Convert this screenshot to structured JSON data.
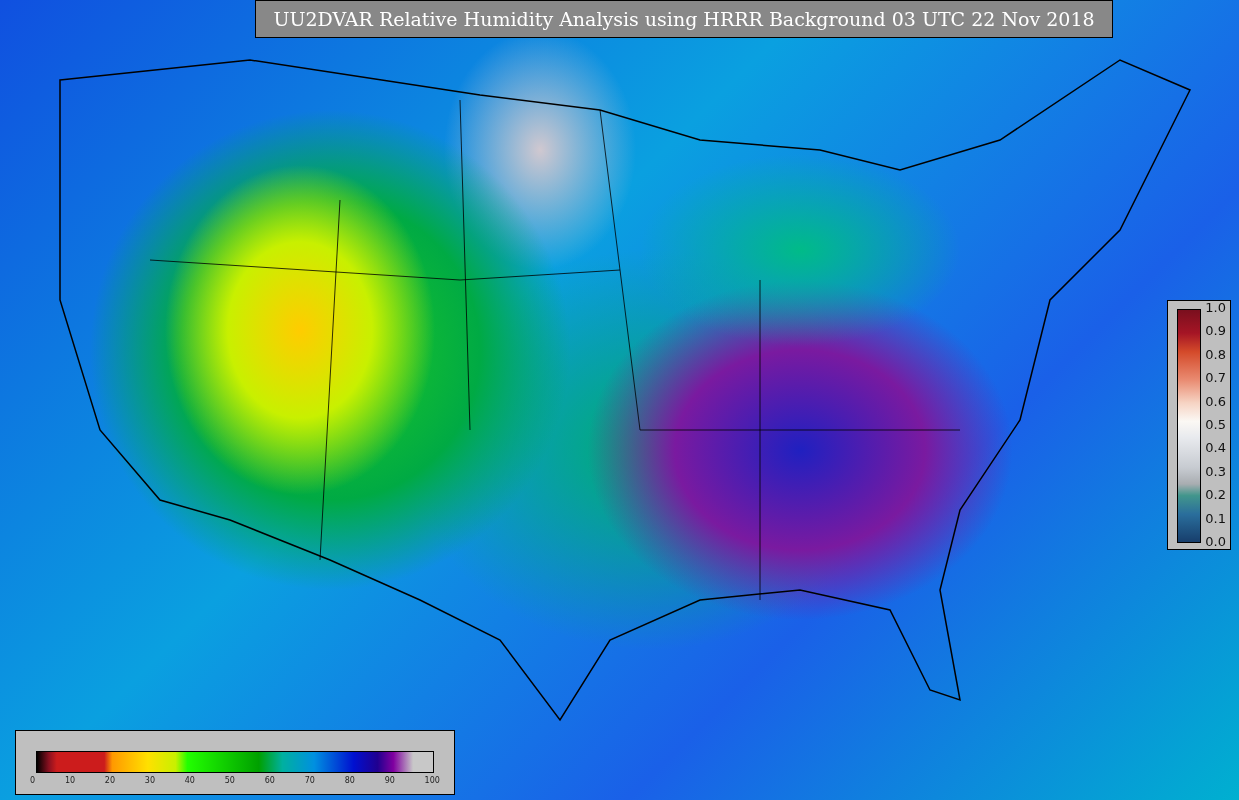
{
  "title": "UU2DVAR Relative Humidity Analysis using HRRR Background 03 UTC 22 Nov 2018",
  "observation_colorbar": {
    "ticks": [
      "1.0",
      "0.9",
      "0.8",
      "0.7",
      "0.6",
      "0.5",
      "0.4",
      "0.3",
      "0.2",
      "0.1",
      "0.0"
    ]
  },
  "humidity_colorbar": {
    "ticks": [
      "0",
      "10",
      "20",
      "30",
      "40",
      "50",
      "60",
      "70",
      "80",
      "90",
      "100"
    ]
  }
}
